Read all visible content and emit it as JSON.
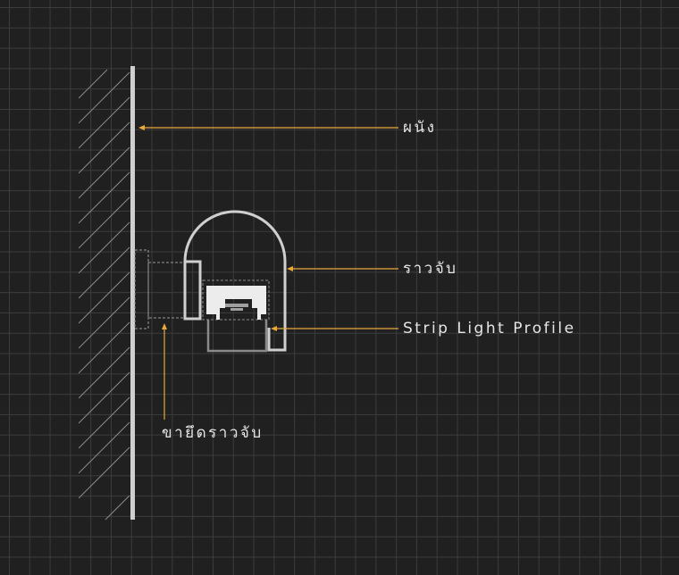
{
  "labels": {
    "wall": "ผนัง",
    "rail": "ราวจับ",
    "profile": "Strip Light Profile",
    "bracket": "ขายึดราวจับ"
  },
  "colors": {
    "background": "#202020",
    "grid": "#3c3c3c",
    "wall": "#cfcfcf",
    "leader": "#e8a83a",
    "text": "#e6e6e6"
  }
}
